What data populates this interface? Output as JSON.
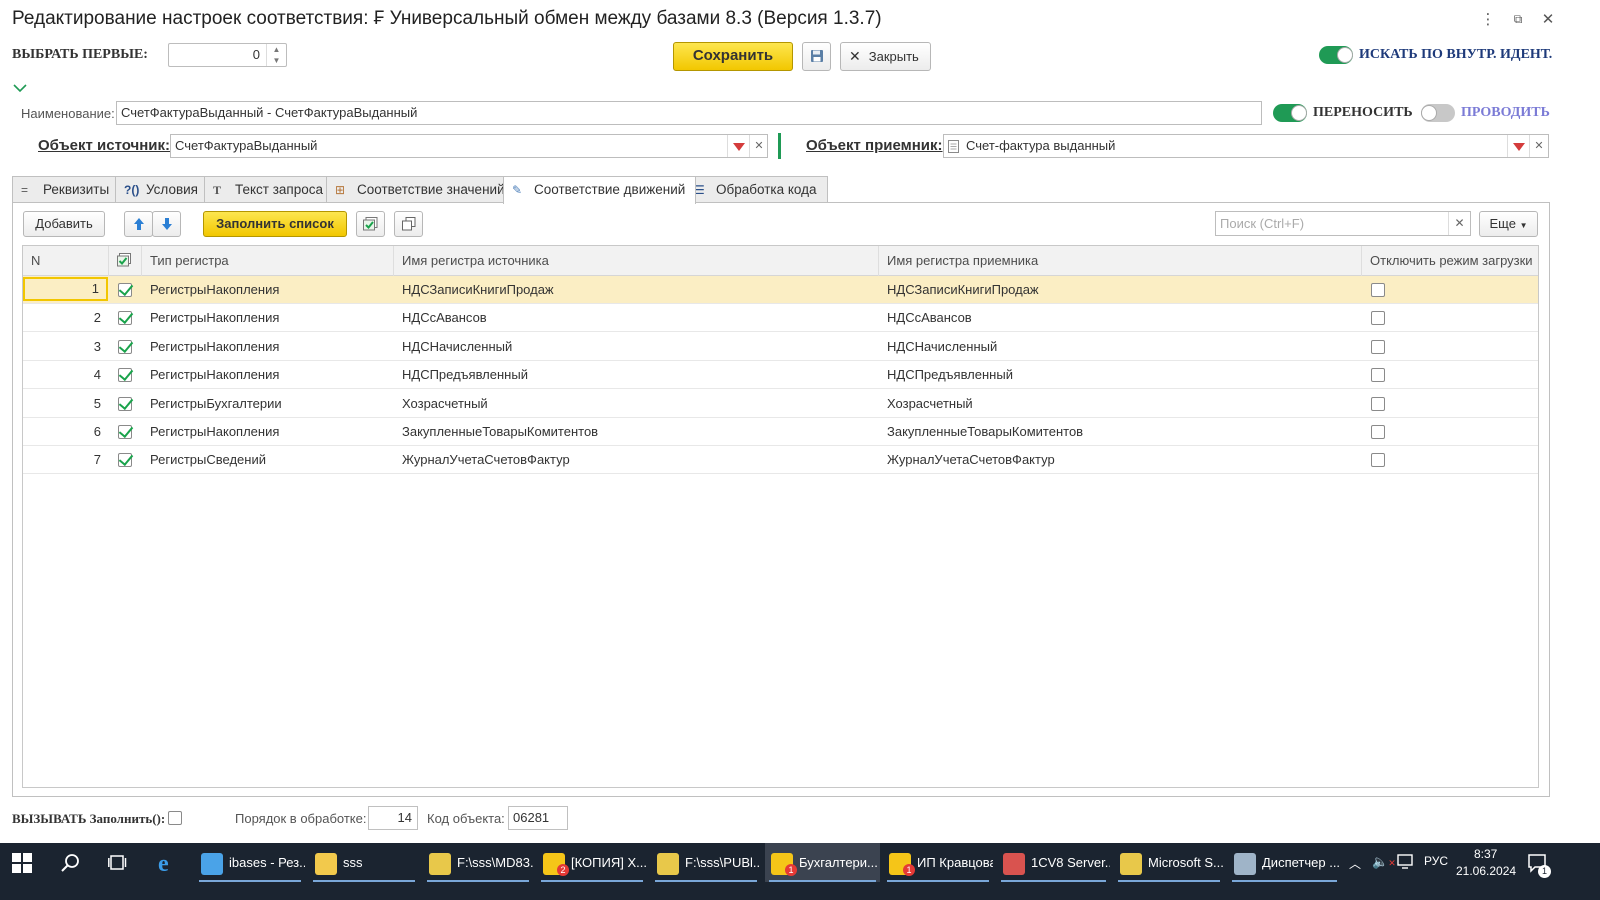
{
  "window": {
    "title": "Редактирование настроек соответствия: ₣ Универсальный обмен между базами 8.3 (Версия 1.3.7)",
    "menu_icon": "⋮",
    "restore_icon": "⧉",
    "close_icon": "✕"
  },
  "top": {
    "select_first_label": "ВЫБРАТЬ ПЕРВЫЕ:",
    "select_first_value": "0",
    "save_label": "Сохранить",
    "close_label": "Закрыть",
    "search_by_id_label": "ИСКАТЬ ПО ВНУТР. ИДЕНТ.",
    "search_by_id_on": true
  },
  "form": {
    "name_label": "Наименование:",
    "name_value": "СчетФактураВыданный - СчетФактураВыданный",
    "transfer_label": "ПЕРЕНОСИТЬ",
    "transfer_on": true,
    "post_label": "ПРОВОДИТЬ",
    "post_on": false,
    "source_label": "Объект источник:",
    "source_value": "СчетФактураВыданный",
    "target_label": "Объект приемник:",
    "target_value": "Счет-фактура выданный"
  },
  "tabs": [
    {
      "label": "Реквизиты",
      "icon": "="
    },
    {
      "label": "Условия",
      "icon": "?()"
    },
    {
      "label": "Текст запроса",
      "icon": "T"
    },
    {
      "label": "Соответствие значений",
      "icon": "⊞"
    },
    {
      "label": "Соответствие движений",
      "icon": "✎",
      "active": true
    },
    {
      "label": "Обработка кода",
      "icon": "☰"
    }
  ],
  "toolbar": {
    "add_label": "Добавить",
    "fill_label": "Заполнить список",
    "search_placeholder": "Поиск (Ctrl+F)",
    "more_label": "Еще"
  },
  "table": {
    "columns": [
      "N",
      "",
      "Тип регистра",
      "Имя регистра источника",
      "Имя регистра приемника",
      "Отключить режим загрузки"
    ],
    "rows": [
      {
        "n": "1",
        "checked": true,
        "type": "РегистрыНакопления",
        "source": "НДСЗаписиКнигиПродаж",
        "target": "НДСЗаписиКнигиПродаж",
        "disable": false
      },
      {
        "n": "2",
        "checked": true,
        "type": "РегистрыНакопления",
        "source": "НДСсАвансов",
        "target": "НДСсАвансов",
        "disable": false
      },
      {
        "n": "3",
        "checked": true,
        "type": "РегистрыНакопления",
        "source": "НДСНачисленный",
        "target": "НДСНачисленный",
        "disable": false
      },
      {
        "n": "4",
        "checked": true,
        "type": "РегистрыНакопления",
        "source": "НДСПредъявленный",
        "target": "НДСПредъявленный",
        "disable": false
      },
      {
        "n": "5",
        "checked": true,
        "type": "РегистрыБухгалтерии",
        "source": "Хозрасчетный",
        "target": "Хозрасчетный",
        "disable": false
      },
      {
        "n": "6",
        "checked": true,
        "type": "РегистрыНакопления",
        "source": "ЗакупленныеТоварыКомитентов",
        "target": "ЗакупленныеТоварыКомитентов",
        "disable": false
      },
      {
        "n": "7",
        "checked": true,
        "type": "РегистрыСведений",
        "source": "ЖурналУчетаСчетовФактур",
        "target": "ЖурналУчетаСчетовФактур",
        "disable": false
      }
    ],
    "selected_row": 0
  },
  "bottom": {
    "call_fill_label": "ВЫЗЫВАТЬ Заполнить():",
    "order_label": "Порядок в обработке:",
    "order_value": "14",
    "code_label": "Код объекта:",
    "code_value": "06281"
  },
  "taskbar": {
    "items": [
      {
        "label": "ibases - Рез...",
        "icon": "cube-icon",
        "color": "#4aa3e8"
      },
      {
        "label": "sss",
        "icon": "folder-icon",
        "color": "#f2c94c"
      },
      {
        "label": "F:\\sss\\MD83...",
        "icon": "chart-app-icon",
        "color": "#e8c84a"
      },
      {
        "label": "[КОПИЯ] Х...",
        "icon": "1c-icon",
        "color": "#f5c518",
        "badge": "2"
      },
      {
        "label": "F:\\sss\\PUBl...",
        "icon": "chart-app-icon",
        "color": "#e8c84a"
      },
      {
        "label": "Бухгалтери...",
        "icon": "1c-icon",
        "color": "#f5c518",
        "badge": "1",
        "active": true
      },
      {
        "label": "ИП Кравцова",
        "icon": "1c-icon",
        "color": "#f5c518",
        "badge": "1"
      },
      {
        "label": "1CV8 Server...",
        "icon": "server-icon",
        "color": "#d9534f"
      },
      {
        "label": "Microsoft S...",
        "icon": "sql-icon",
        "color": "#e8c84a"
      },
      {
        "label": "Диспетчер ...",
        "icon": "task-manager-icon",
        "color": "#9fb4c8"
      }
    ],
    "lang": "РУС",
    "time": "8:37",
    "date": "21.06.2024",
    "notification_count": "1"
  }
}
